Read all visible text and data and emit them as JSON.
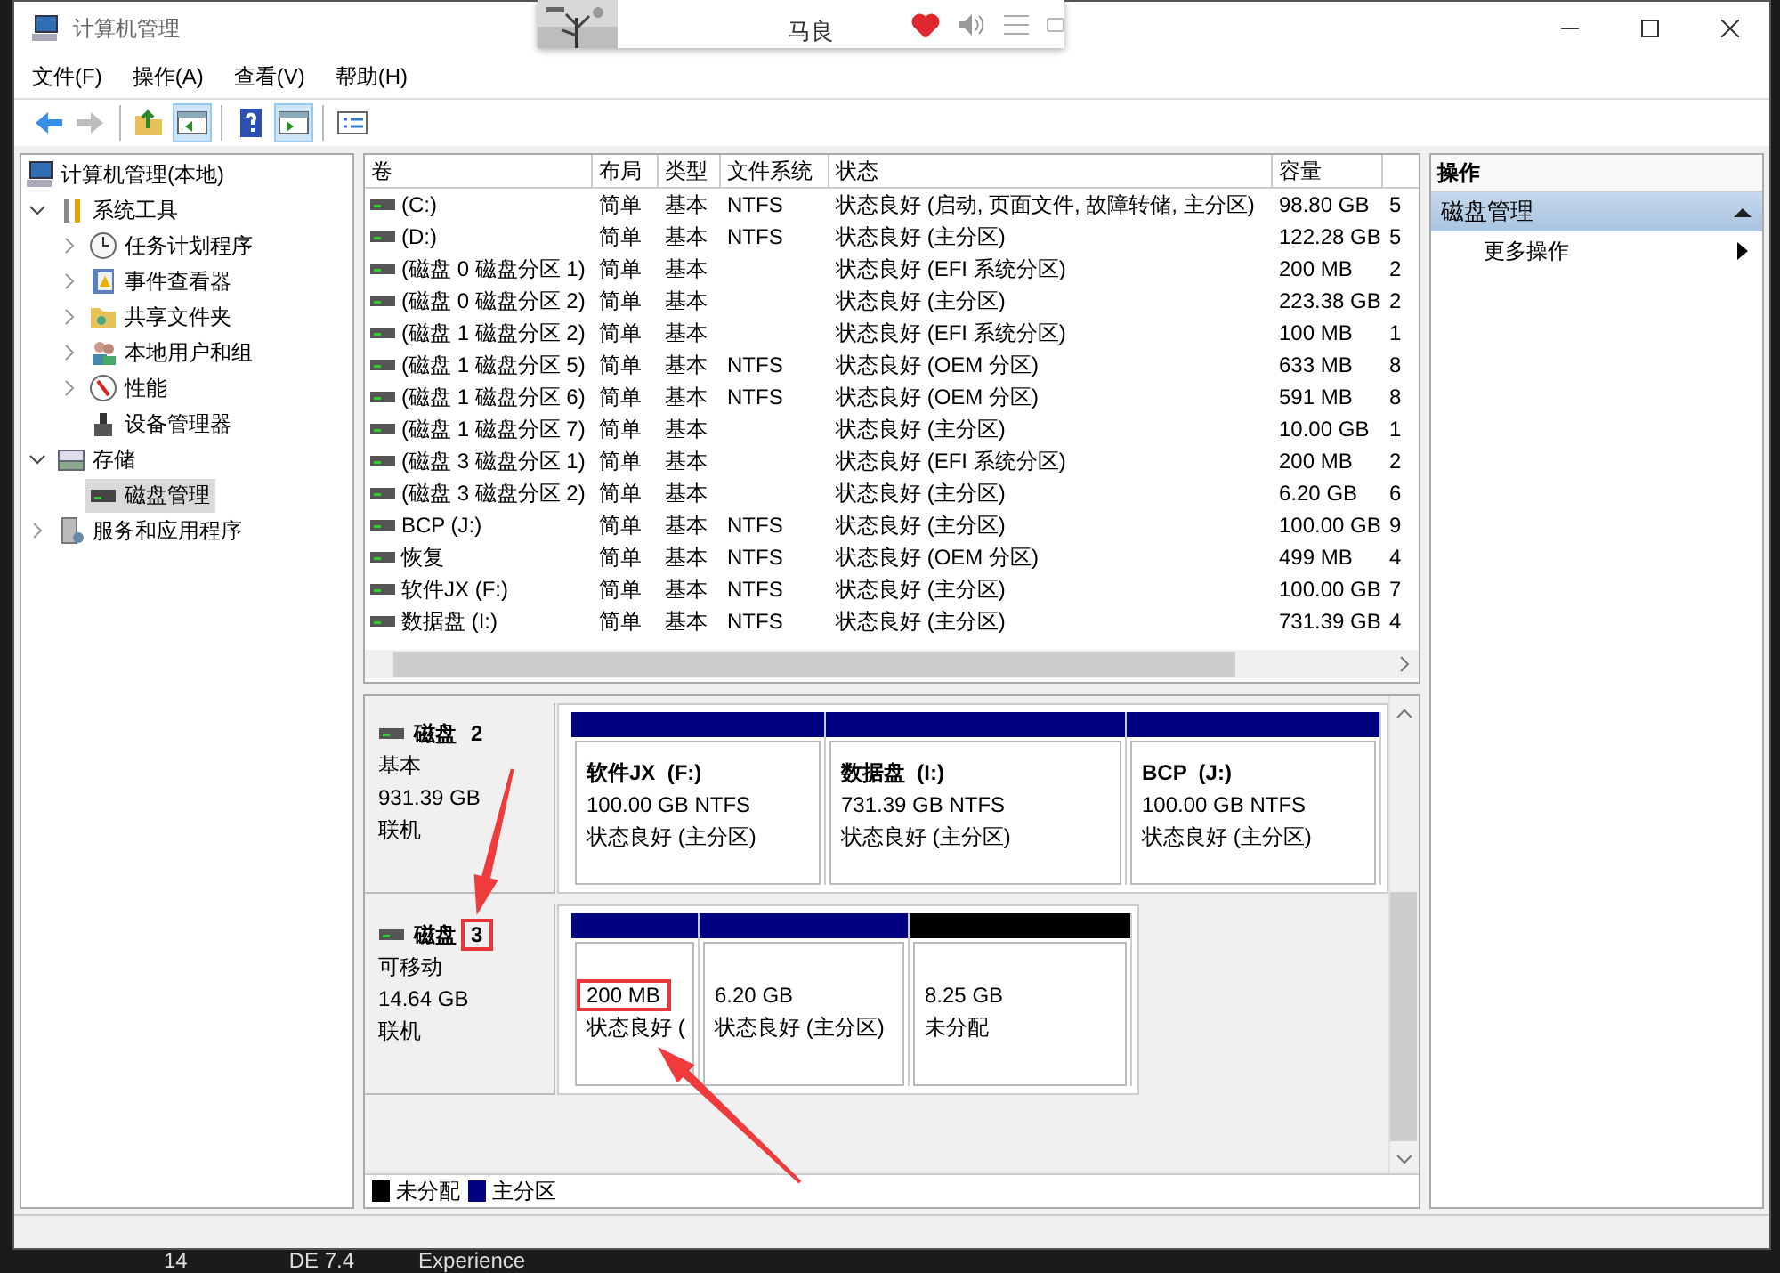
{
  "window": {
    "title": "计算机管理"
  },
  "media_popup": {
    "artist": "马良",
    "liked": true
  },
  "menu": [
    "文件(F)",
    "操作(A)",
    "查看(V)",
    "帮助(H)"
  ],
  "toolbar": [
    [
      {
        "kind": "back",
        "disabled": false,
        "pressed": false
      },
      {
        "kind": "forward",
        "disabled": true,
        "pressed": false
      }
    ],
    [
      {
        "kind": "up",
        "disabled": false,
        "pressed": false
      },
      {
        "kind": "tree",
        "disabled": false,
        "pressed": true
      }
    ],
    [
      {
        "kind": "help",
        "disabled": false,
        "pressed": false
      },
      {
        "kind": "actions",
        "disabled": false,
        "pressed": true
      }
    ],
    [
      {
        "kind": "properties",
        "disabled": false,
        "pressed": false
      }
    ]
  ],
  "tree": [
    {
      "label": "计算机管理(本地)",
      "selected": false,
      "children": [
        {
          "label": "系统工具",
          "expanded": true,
          "selected": false,
          "children": [
            {
              "label": "任务计划程序",
              "expanded": false,
              "selected": false
            },
            {
              "label": "事件查看器",
              "expanded": false,
              "selected": false
            },
            {
              "label": "共享文件夹",
              "expanded": false,
              "selected": false
            },
            {
              "label": "本地用户和组",
              "expanded": false,
              "selected": false
            },
            {
              "label": "性能",
              "expanded": false,
              "selected": false
            },
            {
              "label": "设备管理器",
              "selected": false
            }
          ]
        },
        {
          "label": "存储",
          "expanded": true,
          "selected": false,
          "children": [
            {
              "label": "磁盘管理",
              "selected": true
            }
          ]
        },
        {
          "label": "服务和应用程序",
          "expanded": false,
          "selected": false
        }
      ]
    }
  ],
  "table": {
    "columns": [
      "卷",
      "布局",
      "类型",
      "文件系统",
      "状态",
      "容量"
    ],
    "rows": [
      {
        "volume": "(C:)",
        "layout": "简单",
        "type": "基本",
        "fs": "NTFS",
        "status": "状态良好 (启动, 页面文件, 故障转储, 主分区)",
        "capacity": "98.80 GB",
        "column_7": "5"
      },
      {
        "volume": "(D:)",
        "layout": "简单",
        "type": "基本",
        "fs": "NTFS",
        "status": "状态良好 (主分区)",
        "capacity": "122.28 GB",
        "column_7": "5"
      },
      {
        "volume": "(磁盘 0 磁盘分区 1)",
        "layout": "简单",
        "type": "基本",
        "status": "状态良好 (EFI 系统分区)",
        "capacity": "200 MB",
        "column_7": "2"
      },
      {
        "volume": "(磁盘 0 磁盘分区 2)",
        "layout": "简单",
        "type": "基本",
        "status": "状态良好 (主分区)",
        "capacity": "223.38 GB",
        "column_7": "2"
      },
      {
        "volume": "(磁盘 1 磁盘分区 2)",
        "layout": "简单",
        "type": "基本",
        "status": "状态良好 (EFI 系统分区)",
        "capacity": "100 MB",
        "column_7": "1"
      },
      {
        "volume": "(磁盘 1 磁盘分区 5)",
        "layout": "简单",
        "type": "基本",
        "fs": "NTFS",
        "status": "状态良好 (OEM 分区)",
        "capacity": "633 MB",
        "column_7": "8"
      },
      {
        "volume": "(磁盘 1 磁盘分区 6)",
        "layout": "简单",
        "type": "基本",
        "fs": "NTFS",
        "status": "状态良好 (OEM 分区)",
        "capacity": "591 MB",
        "column_7": "8"
      },
      {
        "volume": "(磁盘 1 磁盘分区 7)",
        "layout": "简单",
        "type": "基本",
        "status": "状态良好 (主分区)",
        "capacity": "10.00 GB",
        "column_7": "1"
      },
      {
        "volume": "(磁盘 3 磁盘分区 1)",
        "layout": "简单",
        "type": "基本",
        "status": "状态良好 (EFI 系统分区)",
        "capacity": "200 MB",
        "column_7": "2"
      },
      {
        "volume": "(磁盘 3 磁盘分区 2)",
        "layout": "简单",
        "type": "基本",
        "status": "状态良好 (主分区)",
        "capacity": "6.20 GB",
        "column_7": "6"
      },
      {
        "volume": "BCP (J:)",
        "layout": "简单",
        "type": "基本",
        "fs": "NTFS",
        "status": "状态良好 (主分区)",
        "capacity": "100.00 GB",
        "column_7": "9"
      },
      {
        "volume": "恢复",
        "layout": "简单",
        "type": "基本",
        "fs": "NTFS",
        "status": "状态良好 (OEM 分区)",
        "capacity": "499 MB",
        "column_7": "4"
      },
      {
        "volume": "软件JX (F:)",
        "layout": "简单",
        "type": "基本",
        "fs": "NTFS",
        "status": "状态良好 (主分区)",
        "capacity": "100.00 GB",
        "column_7": "7"
      },
      {
        "volume": "数据盘 (I:)",
        "layout": "简单",
        "type": "基本",
        "fs": "NTFS",
        "status": "状态良好 (主分区)",
        "capacity": "731.39 GB",
        "column_7": "4"
      }
    ]
  },
  "disks": [
    {
      "name": "磁盘",
      "number": "2",
      "number_highlighted": false,
      "type": "基本",
      "size": "931.39 GB",
      "status": "联机",
      "partitions": [
        {
          "kind": "primary",
          "label": "软件JX  (F:)",
          "size": "100.00 GB NTFS",
          "status": "状态良好 (主分区)",
          "highlighted": false
        },
        {
          "kind": "primary",
          "label": "数据盘  (I:)",
          "size": "731.39 GB NTFS",
          "status": "状态良好 (主分区)",
          "highlighted": false
        },
        {
          "kind": "primary",
          "label": "BCP  (J:)",
          "size": "100.00 GB NTFS",
          "status": "状态良好 (主分区)",
          "highlighted": false
        }
      ]
    },
    {
      "name": "磁盘",
      "number": "3",
      "number_highlighted": true,
      "type": "可移动",
      "size": "14.64 GB",
      "status": "联机",
      "partitions": [
        {
          "kind": "primary",
          "size": "200 MB",
          "status": "状态良好 (",
          "highlighted": true
        },
        {
          "kind": "primary",
          "size": "6.20 GB",
          "status": "状态良好 (主分区)",
          "highlighted": false
        },
        {
          "kind": "unallocated",
          "size": "8.25 GB",
          "status": "未分配",
          "highlighted": false
        }
      ]
    }
  ],
  "legend": [
    {
      "kind": "unallocated",
      "label": "未分配"
    },
    {
      "kind": "primary",
      "label": "主分区"
    }
  ],
  "actions": {
    "header": "操作",
    "sections": [
      {
        "title": "磁盘管理",
        "expanded": true,
        "items": [
          "更多操作"
        ]
      }
    ]
  },
  "desktop_behind": [
    "14",
    "DE 7.4",
    "Experience"
  ]
}
